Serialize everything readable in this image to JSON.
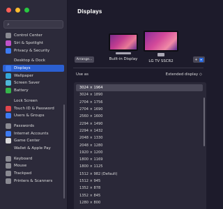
{
  "window": {
    "title": "Displays"
  },
  "sidebar": {
    "items": [
      {
        "label": "Control Center",
        "color": "#8a8a92"
      },
      {
        "label": "Siri & Spotlight",
        "color": "#c052c9"
      },
      {
        "label": "Privacy & Security",
        "color": "#3d7bf2"
      },
      {
        "label": "Desktop & Dock",
        "color": "#2d2d36"
      },
      {
        "label": "Displays",
        "color": "#3d7bf2",
        "active": true
      },
      {
        "label": "Wallpaper",
        "color": "#35a8d8"
      },
      {
        "label": "Screen Saver",
        "color": "#4fb6d9"
      },
      {
        "label": "Battery",
        "color": "#35b54a"
      },
      {
        "label": "Lock Screen",
        "color": "#2d2d36"
      },
      {
        "label": "Touch ID & Password",
        "color": "#e0464d"
      },
      {
        "label": "Users & Groups",
        "color": "#3d7bf2"
      },
      {
        "label": "Passwords",
        "color": "#8a8a92"
      },
      {
        "label": "Internet Accounts",
        "color": "#3d7bf2"
      },
      {
        "label": "Game Center",
        "color": "#d9d9d9"
      },
      {
        "label": "Wallet & Apple Pay",
        "color": "#2d2d36"
      },
      {
        "label": "Keyboard",
        "color": "#8a8a92"
      },
      {
        "label": "Mouse",
        "color": "#8a8a92"
      },
      {
        "label": "Trackpad",
        "color": "#8a8a92"
      },
      {
        "label": "Printers & Scanners",
        "color": "#8a8a92"
      }
    ]
  },
  "main": {
    "arrange_label": "Arrange...",
    "displays": [
      {
        "label": "Built-in Display"
      },
      {
        "label": "LG TV SSCR2",
        "selected": true
      }
    ],
    "add_button": "+",
    "use_as_label": "Use as",
    "use_as_value": "Extended display ◇",
    "resolutions": [
      "3024 × 1964",
      "3024 × 1890",
      "2704 × 1756",
      "2704 × 1690",
      "2560 × 1600",
      "2294 × 1490",
      "2294 × 1432",
      "2048 × 1330",
      "2048 × 1280",
      "1920 × 1200",
      "1800 × 1169",
      "1800 × 1125",
      "1512 × 982 (Default)",
      "1512 × 945",
      "1352 × 878",
      "1352 × 845",
      "1280 × 800"
    ],
    "selected_resolution": "3024 × 1964"
  },
  "colors": {
    "accent": "#2b5fd1",
    "traffic_red": "#ff5f57",
    "traffic_yellow": "#febc2e",
    "traffic_green": "#28c840"
  }
}
